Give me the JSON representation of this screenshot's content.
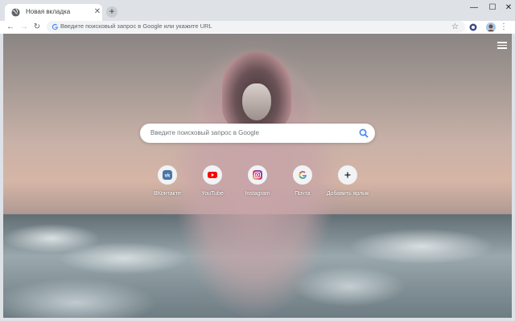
{
  "tab": {
    "title": "Новая вкладка",
    "close_icon": "✕",
    "new_tab_icon": "+"
  },
  "window": {
    "minimize": "—",
    "maximize": "☐",
    "close": "✕"
  },
  "toolbar": {
    "back": "←",
    "forward": "→",
    "reload": "↻",
    "star": "☆",
    "menu": "⋮"
  },
  "omnibox": {
    "placeholder": "Введите поисковый запрос в Google или укажите URL"
  },
  "search": {
    "placeholder": "Введите поисковый запрос в Google"
  },
  "shortcuts": [
    {
      "label": "ВКонтакте",
      "icon": "vk-icon",
      "color": "#4a76a8"
    },
    {
      "label": "YouTube",
      "icon": "youtube-icon",
      "color": "#ff0000"
    },
    {
      "label": "Instagram",
      "icon": "instagram-icon",
      "color": "#c13584"
    },
    {
      "label": "Почта",
      "icon": "google-icon",
      "color": "#4285f4"
    },
    {
      "label": "Добавить ярлык",
      "icon": "plus-icon",
      "color": "#202124"
    }
  ],
  "colors": {
    "accent": "#1a73e8",
    "tabstrip": "#dee1e6"
  }
}
